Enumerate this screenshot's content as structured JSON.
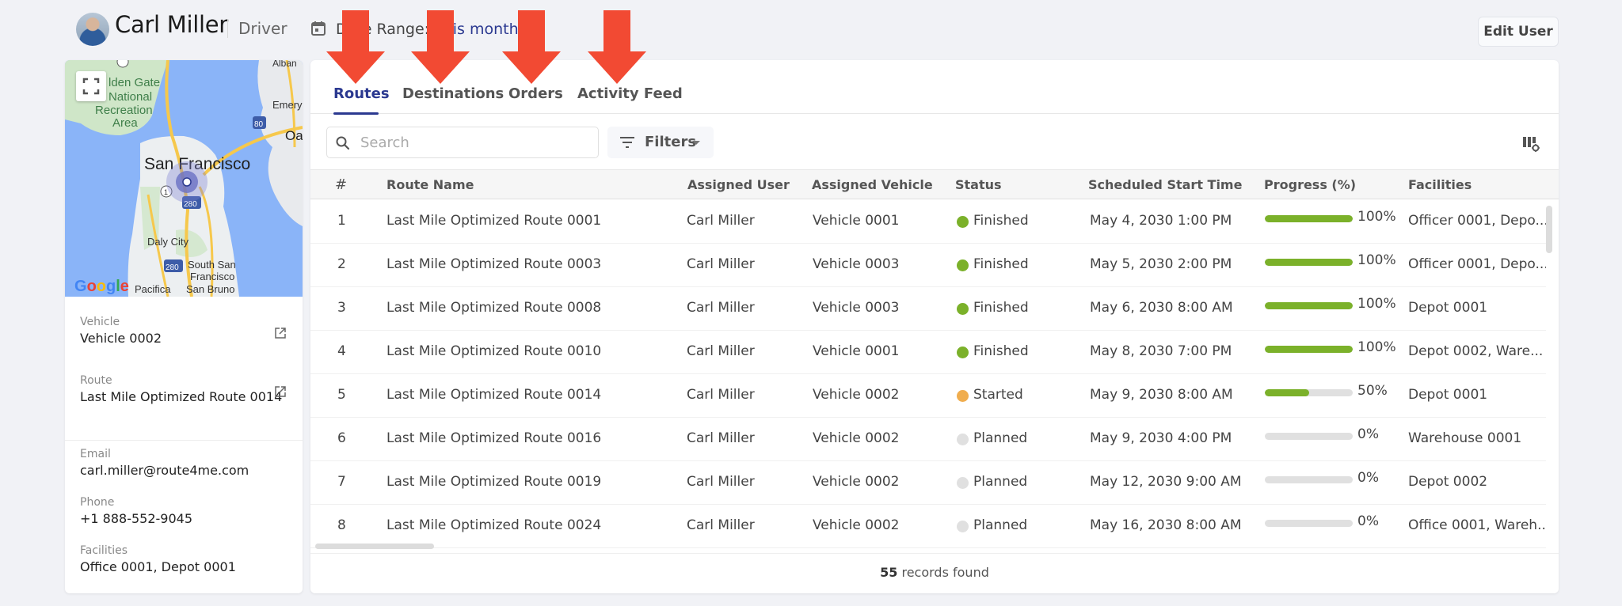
{
  "header": {
    "user_name": "Carl Miller",
    "user_role": "Driver",
    "date_range_label": "Date Range:",
    "date_range_value": "This month",
    "edit_user_label": "Edit User"
  },
  "map": {
    "labels": [
      "Golden Gate National Recreation Area",
      "San Francisco",
      "Daly City",
      "South San Francisco",
      "Pacifica",
      "San Bruno",
      "Albany",
      "Emeryville",
      "Oakland"
    ],
    "attribution": "Google"
  },
  "details": {
    "vehicle_label": "Vehicle",
    "vehicle_value": "Vehicle 0002",
    "route_label": "Route",
    "route_value": "Last Mile Optimized Route 0014",
    "email_label": "Email",
    "email_value": "carl.miller@route4me.com",
    "phone_label": "Phone",
    "phone_value": "+1 888-552-9045",
    "facilities_label": "Facilities",
    "facilities_value": "Office 0001, Depot 0001"
  },
  "tabs": [
    {
      "label": "Routes",
      "active": true
    },
    {
      "label": "Destinations",
      "active": false
    },
    {
      "label": "Orders",
      "active": false
    },
    {
      "label": "Activity Feed",
      "active": false
    }
  ],
  "toolbar": {
    "search_placeholder": "Search",
    "filters_label": "Filters"
  },
  "table": {
    "columns": [
      "#",
      "Route Name",
      "Assigned User",
      "Assigned Vehicle",
      "Status",
      "Scheduled Start Time",
      "Progress (%)",
      "Facilities"
    ],
    "rows": [
      {
        "num": "1",
        "route": "Last Mile Optimized Route 0001",
        "user": "Carl Miller",
        "vehicle": "Vehicle 0001",
        "status": "Finished",
        "start": "May 4, 2030 1:00 PM",
        "progress": 100,
        "progress_text": "100%",
        "facilities": "Officer 0001, Depo..."
      },
      {
        "num": "2",
        "route": "Last Mile Optimized Route 0003",
        "user": "Carl Miller",
        "vehicle": "Vehicle 0003",
        "status": "Finished",
        "start": "May 5, 2030 2:00 PM",
        "progress": 100,
        "progress_text": "100%",
        "facilities": "Officer 0001, Depo..."
      },
      {
        "num": "3",
        "route": "Last Mile Optimized Route 0008",
        "user": "Carl Miller",
        "vehicle": "Vehicle 0003",
        "status": "Finished",
        "start": "May 6, 2030 8:00 AM",
        "progress": 100,
        "progress_text": "100%",
        "facilities": "Depot 0001"
      },
      {
        "num": "4",
        "route": "Last Mile Optimized Route 0010",
        "user": "Carl Miller",
        "vehicle": "Vehicle 0001",
        "status": "Finished",
        "start": "May 8, 2030 7:00 PM",
        "progress": 100,
        "progress_text": "100%",
        "facilities": "Depot 0002, Ware..."
      },
      {
        "num": "5",
        "route": "Last Mile Optimized Route 0014",
        "user": "Carl Miller",
        "vehicle": "Vehicle 0002",
        "status": "Started",
        "start": "May 9, 2030 8:00 AM",
        "progress": 50,
        "progress_text": "50%",
        "facilities": "Depot 0001"
      },
      {
        "num": "6",
        "route": "Last Mile Optimized Route 0016",
        "user": "Carl Miller",
        "vehicle": "Vehicle 0002",
        "status": "Planned",
        "start": "May 9, 2030 4:00 PM",
        "progress": 0,
        "progress_text": "0%",
        "facilities": "Warehouse 0001"
      },
      {
        "num": "7",
        "route": "Last Mile Optimized Route 0019",
        "user": "Carl Miller",
        "vehicle": "Vehicle 0002",
        "status": "Planned",
        "start": "May 12, 2030 9:00 AM",
        "progress": 0,
        "progress_text": "0%",
        "facilities": "Depot 0002"
      },
      {
        "num": "8",
        "route": "Last Mile Optimized Route 0024",
        "user": "Carl Miller",
        "vehicle": "Vehicle 0002",
        "status": "Planned",
        "start": "May 16, 2030 8:00 AM",
        "progress": 0,
        "progress_text": "0%",
        "facilities": "Office 0001, Wareh..."
      }
    ]
  },
  "footer": {
    "count": "55",
    "suffix": " records found"
  },
  "colors": {
    "accent": "#2b3990",
    "finished": "#7bb12a",
    "started": "#f0ad4e",
    "planned": "#e0e0e0",
    "progress_fill": "#7bb12a",
    "annotation_arrow": "#f24a33"
  }
}
